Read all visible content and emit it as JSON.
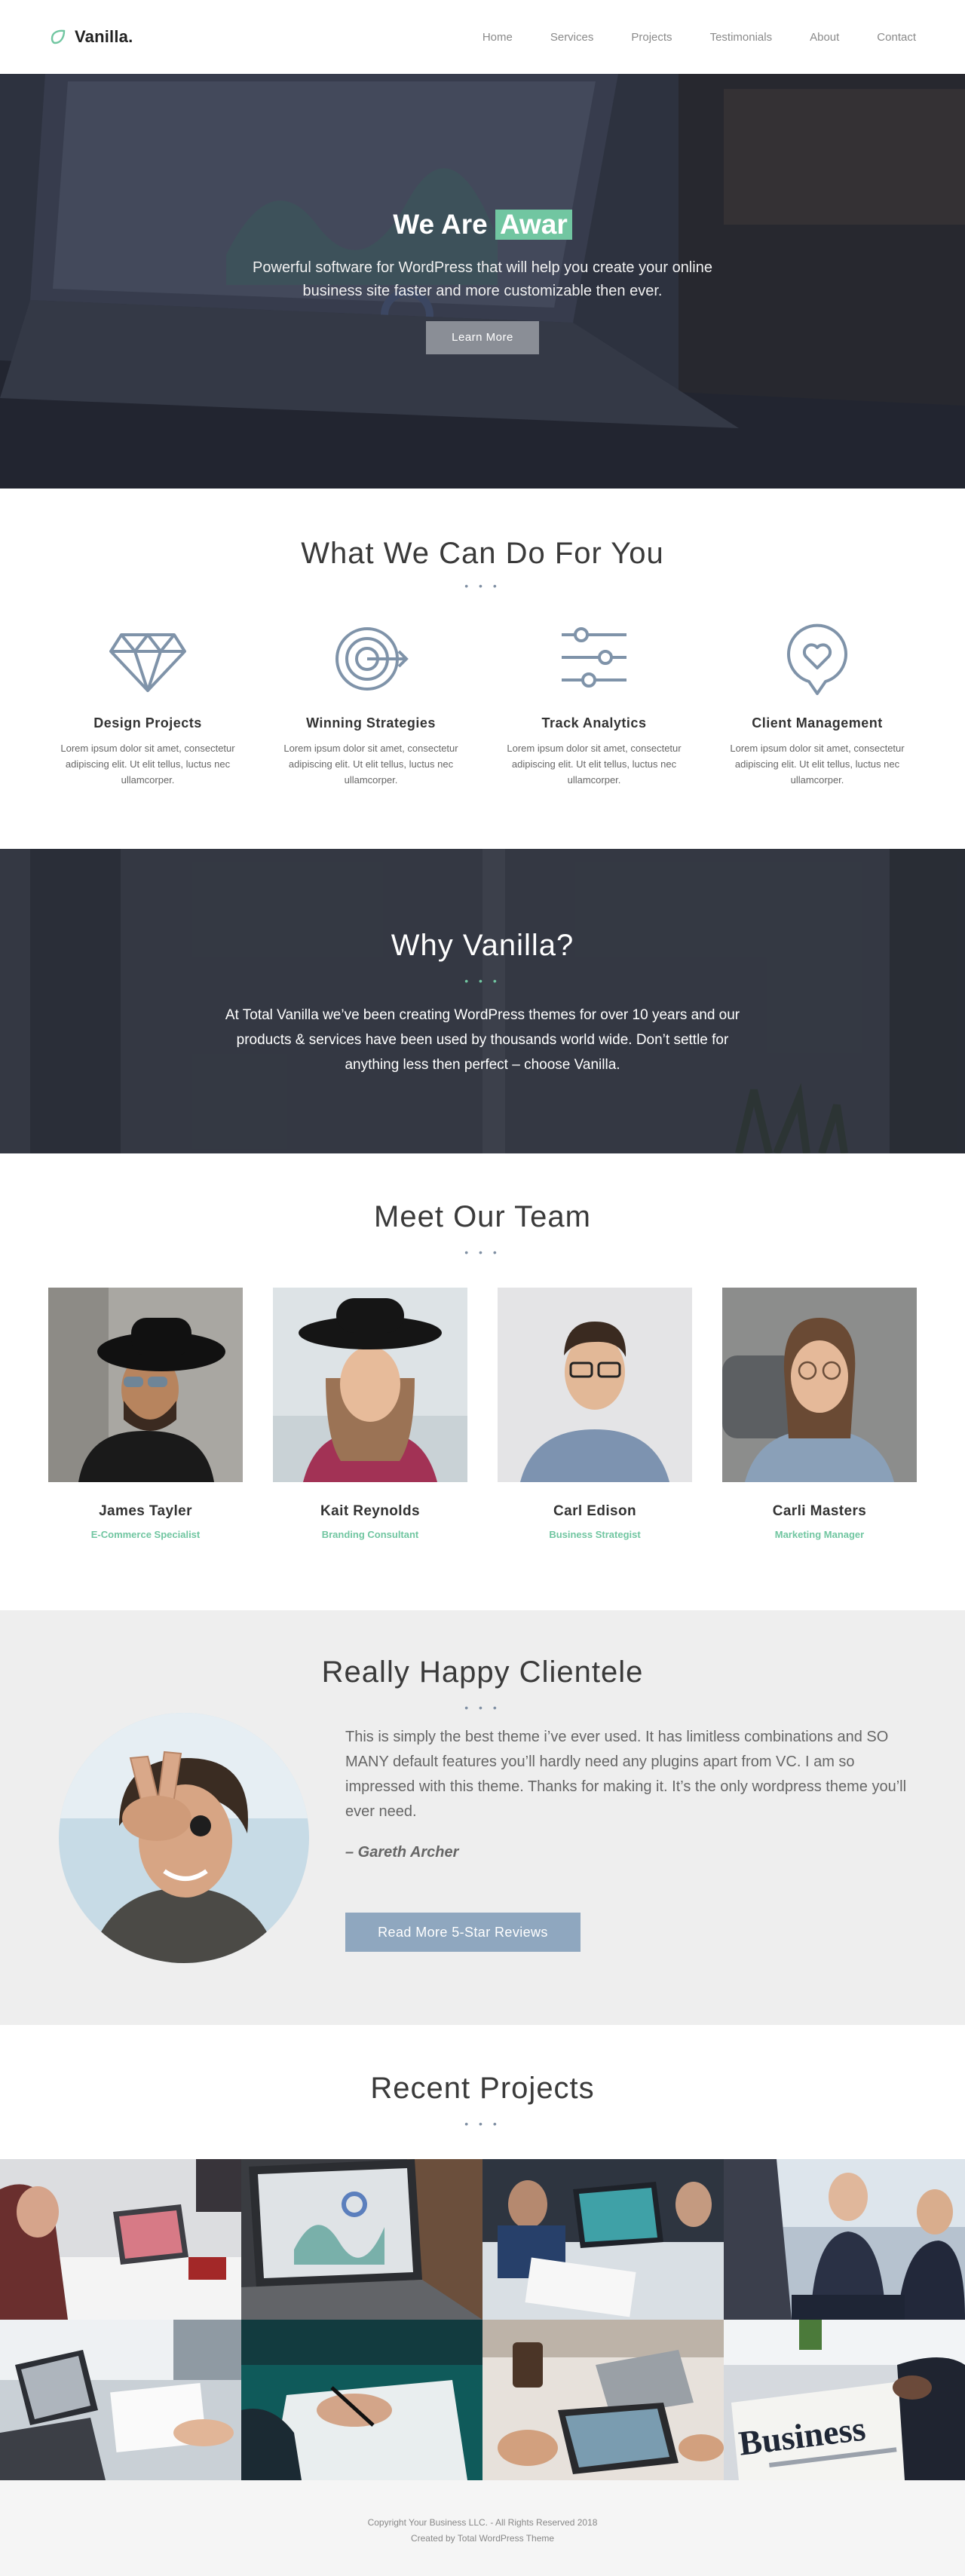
{
  "brand": {
    "name": "Vanilla.",
    "accent": "#71c6a1"
  },
  "nav": {
    "items": [
      {
        "label": "Home"
      },
      {
        "label": "Services"
      },
      {
        "label": "Projects"
      },
      {
        "label": "Testimonials"
      },
      {
        "label": "About"
      },
      {
        "label": "Contact"
      }
    ]
  },
  "hero": {
    "title_prefix": "We Are",
    "title_highlight": "Awar",
    "subtitle": "Powerful software for WordPress that will help you create your online business site faster and more customizable then ever.",
    "button_label": "Learn More"
  },
  "services": {
    "title": "What We Can Do For You",
    "dots": "• • •",
    "items": [
      {
        "icon": "diamond-icon",
        "title": "Design Projects",
        "text": "Lorem ipsum dolor sit amet, consectetur adipiscing elit. Ut elit tellus, luctus nec ullamcorper."
      },
      {
        "icon": "target-icon",
        "title": "Winning Strategies",
        "text": "Lorem ipsum dolor sit amet, consectetur adipiscing elit. Ut elit tellus, luctus nec ullamcorper."
      },
      {
        "icon": "sliders-icon",
        "title": "Track Analytics",
        "text": "Lorem ipsum dolor sit amet, consectetur adipiscing elit. Ut elit tellus, luctus nec ullamcorper."
      },
      {
        "icon": "heart-bubble-icon",
        "title": "Client Management",
        "text": "Lorem ipsum dolor sit amet, consectetur adipiscing elit. Ut elit tellus, luctus nec ullamcorper."
      }
    ]
  },
  "why": {
    "title": "Why Vanilla?",
    "dots": "• • •",
    "text": "At Total Vanilla we’ve been creating WordPress themes for over 10 years and our products & services have been used by thousands world wide. Don’t settle for anything less then perfect – choose Vanilla."
  },
  "team": {
    "title": "Meet Our Team",
    "dots": "• • •",
    "members": [
      {
        "name": "James Tayler",
        "role": "E-Commerce Specialist"
      },
      {
        "name": "Kait Reynolds",
        "role": "Branding Consultant"
      },
      {
        "name": "Carl Edison",
        "role": "Business Strategist"
      },
      {
        "name": "Carli Masters",
        "role": "Marketing Manager"
      }
    ]
  },
  "testimonial": {
    "title": "Really Happy Clientele",
    "dots": "• • •",
    "quote": "This is simply the best theme i’ve ever used. It has limitless combinations and SO MANY default features you’ll hardly need any plugins apart from VC. I am so impressed with this theme. Thanks for making it. It’s the only wordpress theme you’ll ever need.",
    "author": "– Gareth Archer",
    "button_label": "Read More 5-Star Reviews"
  },
  "projects": {
    "title": "Recent Projects",
    "dots": "• • •",
    "tile_text": "Business"
  },
  "footer": {
    "copyright": "Copyright Your Business LLC. - All Rights Reserved 2018",
    "credit": "Created by Total WordPress Theme"
  }
}
